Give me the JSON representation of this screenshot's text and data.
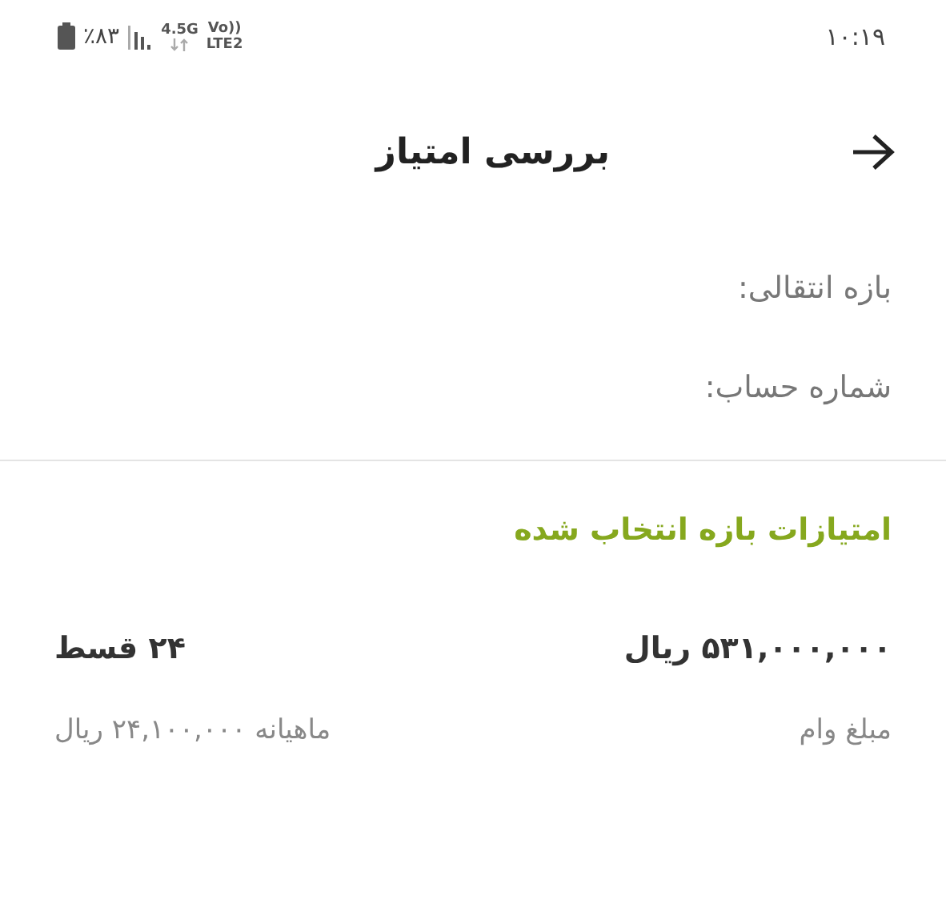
{
  "status_bar": {
    "time": "۱۰:۱۹",
    "battery": "٪۸۳",
    "network": "4.5G",
    "volte": "Vo))",
    "carrier": "LTE2"
  },
  "header": {
    "title": "بررسی امتیاز"
  },
  "fields": [
    {
      "label": "بازه انتقالی:"
    },
    {
      "label": "شماره حساب:"
    }
  ],
  "section": {
    "title": "امتیازات بازه انتخاب شده"
  },
  "summary": {
    "amount": "۵۳۱,۰۰۰,۰۰۰ ریال",
    "installments": "۲۴ قسط",
    "amount_label": "مبلغ وام",
    "monthly": "ماهیانه ۲۴,۱۰۰,۰۰۰ ریال"
  }
}
